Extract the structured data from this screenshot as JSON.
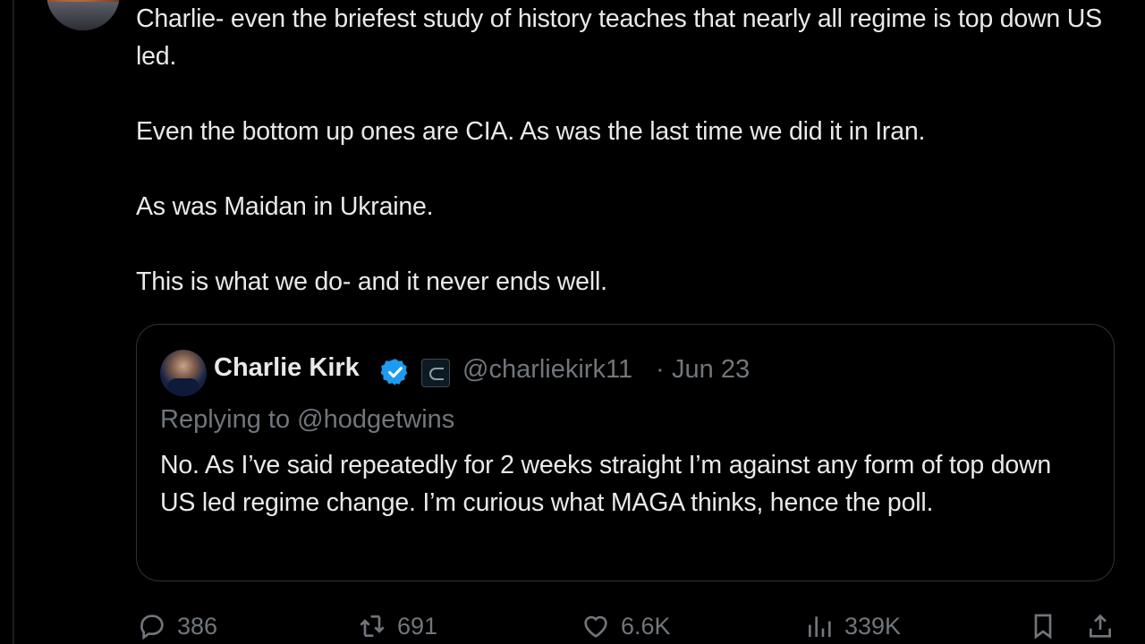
{
  "tweet": {
    "paragraphs": [
      "Charlie- even the briefest study of history teaches that nearly all regime is top down US led.",
      "Even the bottom up ones are CIA. As was the last time we did it in Iran.",
      "As was Maidan in Ukraine.",
      "This is what we do- and it never ends well."
    ]
  },
  "quote": {
    "name": "Charlie Kirk",
    "handle": "@charliekirk11",
    "separator": "·",
    "date": "Jun 23",
    "replying_prefix": "Replying to ",
    "replying_to": "@hodgetwins",
    "text": "No. As I’ve said repeatedly for 2 weeks straight I’m against any form of top down US led regime change. I’m curious what MAGA thinks, hence the poll."
  },
  "actions": {
    "replies": "386",
    "reposts": "691",
    "likes": "6.6K",
    "views": "339K"
  },
  "icons": {
    "reply": "reply-icon",
    "repost": "repost-icon",
    "like": "heart-icon",
    "views": "views-icon",
    "bookmark": "bookmark-icon",
    "share": "share-icon",
    "verified": "verified-badge-icon"
  },
  "colors": {
    "background": "#000000",
    "text": "#e7e9ea",
    "muted": "#71767b",
    "verified": "#1d9bf0",
    "border": "#2f3336"
  }
}
